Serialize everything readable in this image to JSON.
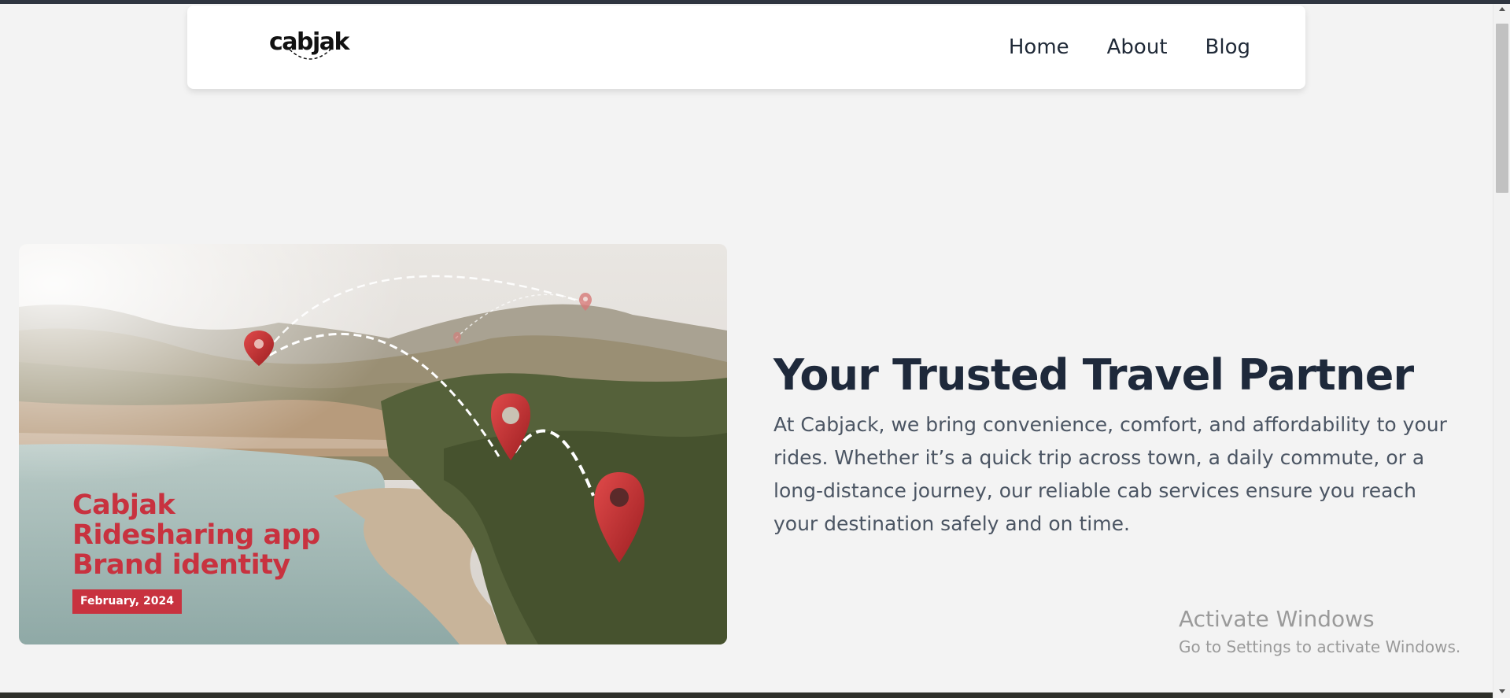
{
  "navbar": {
    "logo_text": "cabjak",
    "links": [
      {
        "label": "Home"
      },
      {
        "label": "About"
      },
      {
        "label": "Blog"
      }
    ]
  },
  "hero": {
    "image": {
      "brand_lines": [
        "Cabjak",
        "Ridesharing app",
        "Brand identity"
      ],
      "date": "February, 2024",
      "accent_color": "#c8323f"
    },
    "title": "Your Trusted Travel Partner",
    "body": "At Cabjack, we bring convenience, comfort, and affordability to your rides. Whether it’s a quick trip across town, a daily commute, or a long-distance journey, our reliable cab services ensure you reach your destination safely and on time."
  },
  "watermark": {
    "title": "Activate Windows",
    "subtitle": "Go to Settings to activate Windows."
  },
  "colors": {
    "page_background": "#f3f3f3",
    "heading": "#1e293b",
    "body_text": "#4b5563"
  }
}
